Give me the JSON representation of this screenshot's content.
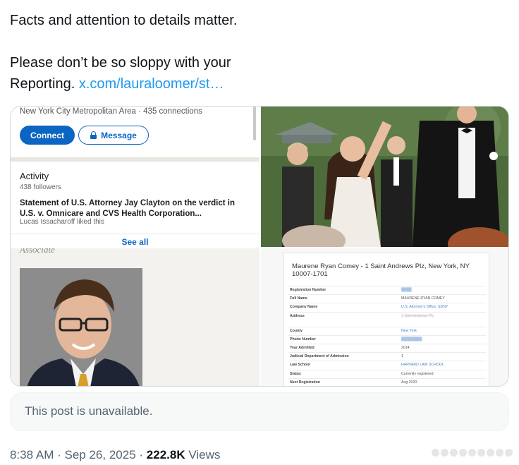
{
  "post": {
    "line1": "Facts and attention to details matter.",
    "line2": "Please don’t be so sloppy with your",
    "line3_prefix": "Reporting. ",
    "link_text": "x.com/lauraloomer/st…"
  },
  "linkedin": {
    "location": "New York City Metropolitan Area",
    "connections": "435 connections",
    "connect_label": "Connect",
    "message_label": "Message",
    "activity_heading": "Activity",
    "followers": "438 followers",
    "post_title": "Statement of U.S. Attorney Jay Clayton on the verdict in U.S. v. Omnicare and CVS Health Corporation...",
    "liked_by": "Lucas Issacharoff liked this",
    "see_all": "See all"
  },
  "headshot": {
    "caption": "Associate"
  },
  "bar_record": {
    "title": "Maurene Ryan Comey - 1 Saint Andrews Plz, New York, NY 10007-1701",
    "rows": [
      {
        "label": "Registration Number",
        "value": "████"
      },
      {
        "label": "Full Name",
        "value": "MAURENE RYAN COMEY"
      },
      {
        "label": "Company Name",
        "value": "U.S. Attorney's Office, SDNY"
      },
      {
        "label": "Address",
        "value": "1 Saint Andrews Plz"
      },
      {
        "label": "County",
        "value": "New York"
      },
      {
        "label": "Phone Number",
        "value": "████████"
      },
      {
        "label": "Year Admitted",
        "value": "2014"
      },
      {
        "label": "Judicial Department of Admission",
        "value": "1"
      },
      {
        "label": "Law School",
        "value": "HARVARD LAW SCHOOL"
      },
      {
        "label": "Status",
        "value": "Currently registered"
      },
      {
        "label": "Next Registration",
        "value": "Aug 2020"
      }
    ]
  },
  "unavailable_text": "This post is unavailable.",
  "meta": {
    "time": "8:38 AM",
    "date": "Sep 26, 2025",
    "views_count": "222.8K",
    "views_label": "Views"
  },
  "colors": {
    "link": "#1d9bf0",
    "linkedin_blue": "#0a66c2",
    "muted": "#536471"
  }
}
